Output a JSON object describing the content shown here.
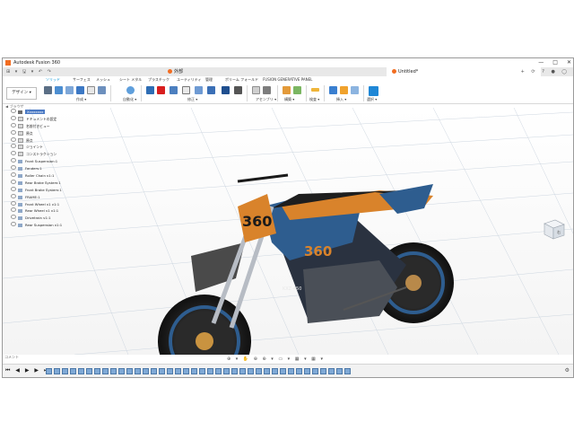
{
  "window": {
    "title": "Autodesk Fusion 360",
    "controls": [
      "—",
      "□",
      "✕"
    ]
  },
  "tabs": {
    "quick_access": "⊞ ▾ 🖫 ▾ ↶ ↷",
    "tab1": "外部",
    "tab2": "Untitled*",
    "right_icons": "+ ⟳ ? ● ◯"
  },
  "ribbon_tabs": [
    "ソリッド",
    "サーフェス",
    "メッシュ",
    "シート メタル",
    "プラスチック",
    "ユーティリティ",
    "管理",
    "ポリーム フォールド",
    "FUSION GENERATIVE PANEL"
  ],
  "ribbon": {
    "design_label": "デザイン ▾",
    "groups": [
      "作成 ▾",
      "自動化 ▾",
      "修正 ▾",
      "アセンブリ ▾",
      "構築 ▾",
      "検査 ▾",
      "挿入 ▾",
      "選択 ▾"
    ]
  },
  "browser": {
    "header": "◀ ブラウザ",
    "items": [
      {
        "label": "Xxxxxxxx",
        "type": "root"
      },
      {
        "label": "ドキュメントの設定",
        "type": "folder"
      },
      {
        "label": "名前付きビュー",
        "type": "folder"
      },
      {
        "label": "原点",
        "type": "folder"
      },
      {
        "label": "原点",
        "type": "folder"
      },
      {
        "label": "ジョイント",
        "type": "folder"
      },
      {
        "label": "コンストラクション",
        "type": "folder"
      },
      {
        "label": "Front Suspension:1",
        "type": "comp"
      },
      {
        "label": "Fenders:1",
        "type": "comp"
      },
      {
        "label": "Roller Chain v1:1",
        "type": "comp"
      },
      {
        "label": "Rear Brake System:1",
        "type": "comp"
      },
      {
        "label": "Front Brake System:1",
        "type": "comp"
      },
      {
        "label": "FRAME:1",
        "type": "comp"
      },
      {
        "label": "Front Wheel v1 v1:1",
        "type": "comp"
      },
      {
        "label": "Rear Wheel v1 v1:1",
        "type": "comp"
      },
      {
        "label": "Drivetrain v1:1",
        "type": "comp"
      },
      {
        "label": "Rear Suspension v1:1",
        "type": "comp"
      }
    ]
  },
  "model": {
    "number_plate": "360",
    "side_panel_number": "360",
    "model_label": "KXZ-450"
  },
  "viewcube_label": "右",
  "navbar": "⊕ ▾ ✋ ⊕ ⊕ ▾ ▭ ▾ ▦ ▾ ▦ ▾",
  "comments": "コメント",
  "timeline": {
    "controls": "⏮ ◀ ▶ ▶ ⏭",
    "item_count": 38,
    "gear": "⚙"
  },
  "colors": {
    "accent": "#0696d7",
    "brand": "#f26d21",
    "bike_blue": "#2e5d8f",
    "bike_orange": "#d9832b"
  }
}
